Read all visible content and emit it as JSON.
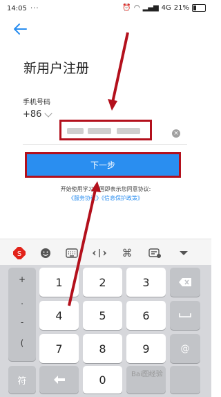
{
  "status_bar": {
    "time": "14:05",
    "dots": "···",
    "network": "4G",
    "battery": "21%"
  },
  "page": {
    "title": "新用户注册"
  },
  "form": {
    "phone_label": "手机号码",
    "country_code": "+86",
    "next_button": "下一步",
    "agreement_prefix": "开始使用学习强国即表示您同意协议:",
    "agreement_link_1": "《服务协议》",
    "agreement_link_2": "《信息保护政策》"
  },
  "keyboard": {
    "symbols": [
      "+",
      ".",
      "-",
      "("
    ],
    "digits": [
      "1",
      "2",
      "3",
      "4",
      "5",
      "6",
      "7",
      "8",
      "9"
    ],
    "sym_key": "符",
    "zero": "0",
    "at_key": "@",
    "toolbar_icons": [
      "sogou-icon",
      "emoji-icon",
      "keyboard-icon",
      "cursor-icon",
      "command-icon",
      "clipboard-icon",
      "collapse-icon"
    ]
  },
  "annotation_color": "#b3101c",
  "accent_color": "#2a8ef0",
  "watermark": {
    "text": "Bai图经验"
  }
}
